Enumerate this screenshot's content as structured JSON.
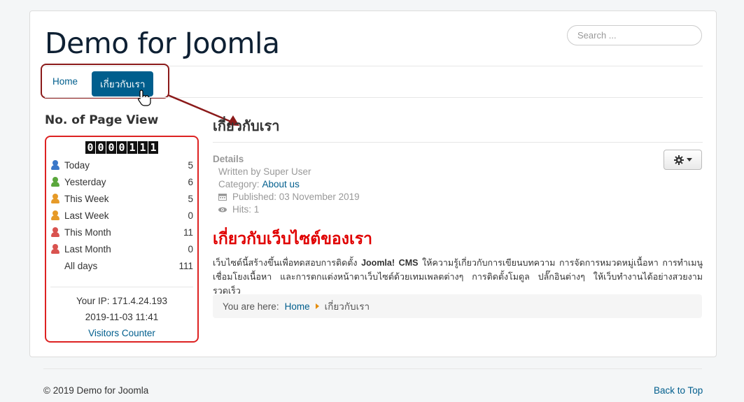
{
  "site": {
    "title": "Demo for Joomla"
  },
  "search": {
    "placeholder": "Search ..."
  },
  "nav": {
    "items": [
      {
        "label": "Home"
      },
      {
        "label": "เกี่ยวกับเรา"
      }
    ],
    "active_index": 1
  },
  "sidebar": {
    "title": "No. of Page View",
    "counter_digits": [
      "0",
      "0",
      "0",
      "0",
      "1",
      "1",
      "1"
    ],
    "stats": [
      {
        "label": "Today",
        "value": "5",
        "icon": "user-blue-icon",
        "color": "#3a78c9"
      },
      {
        "label": "Yesterday",
        "value": "6",
        "icon": "user-green-icon",
        "color": "#5aa73c"
      },
      {
        "label": "This Week",
        "value": "5",
        "icon": "user-orange-icon",
        "color": "#e69a28"
      },
      {
        "label": "Last Week",
        "value": "0",
        "icon": "user-orange-icon",
        "color": "#e69a28"
      },
      {
        "label": "This Month",
        "value": "11",
        "icon": "user-red-icon",
        "color": "#d9534f"
      },
      {
        "label": "Last Month",
        "value": "0",
        "icon": "user-red-icon",
        "color": "#d9534f"
      },
      {
        "label": "All days",
        "value": "111",
        "icon": "bar-chart-icon",
        "color": "#4a7fcf"
      }
    ],
    "your_ip": "Your IP: 171.4.24.193",
    "datetime": "2019-11-03 11:41",
    "link": "Visitors Counter"
  },
  "article": {
    "title": "เกี่ยวกับเรา",
    "details_label": "Details",
    "written_by": "Written by Super User",
    "category_label": "Category:",
    "category_value": "About us",
    "published": "Published: 03 November 2019",
    "hits": "Hits: 1",
    "heading": "เกี่ยวกับเว็บไซต์ของเรา",
    "body_pre": "เว็บไซต์นี้สร้างขึ้นเพื่อทดสอบการติดตั้ง",
    "body_bold": "Joomla! CMS",
    "body_post": "ให้ความรู้เกี่ยวกับการเขียนบทความ การจัดการหมวดหมู่เนื้อหา การทำเมนูเชื่อมโยงเนื้อหา และการตกแต่งหน้าตาเว็บไซต์ด้วยเทมเพลตต่างๆ การติดตั้งโมดูล ปลั๊กอินต่างๆ ให้เว็บทำงานได้อย่างสวยงาม รวดเร็ว"
  },
  "breadcrumb": {
    "prefix": "You are here:",
    "home": "Home",
    "current": "เกี่ยวกับเรา"
  },
  "footer": {
    "copyright": "© 2019 Demo for Joomla",
    "back_to_top": "Back to Top"
  },
  "colors": {
    "accent": "#005e8d",
    "annotation": "#8b1a1a",
    "highlight_box": "#dd2222",
    "heading_red": "#e00000"
  }
}
